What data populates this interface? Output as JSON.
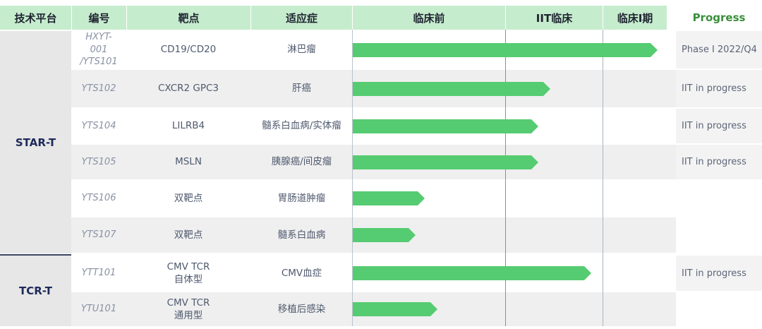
{
  "header": {
    "platform": "技术平台",
    "code": "编号",
    "target": "靶点",
    "indication": "适应症",
    "preclinical": "临床前",
    "iit": "IIT临床",
    "phase1": "临床I期",
    "progress": "Progress"
  },
  "platforms": [
    {
      "name": "STAR-T"
    },
    {
      "name": "TCR-T"
    }
  ],
  "rows": [
    {
      "code": "HXYT-\n001\n/YTS101",
      "target": "CD19/CD20",
      "indication": "淋巴瘤",
      "progress": "Phase I 2022/Q4",
      "stage_fraction": 0.97
    },
    {
      "code": "YTS102",
      "target": "CXCR2 GPC3",
      "indication": "肝癌",
      "progress": "IIT in progress",
      "stage_fraction": 0.63
    },
    {
      "code": "YTS104",
      "target": "LILRB4",
      "indication": "髓系白血病/实体瘤",
      "progress": "IIT in progress",
      "stage_fraction": 0.59
    },
    {
      "code": "YTS105",
      "target": "MSLN",
      "indication": "胰腺癌/间皮瘤",
      "progress": "IIT in progress",
      "stage_fraction": 0.59
    },
    {
      "code": "YTS106",
      "target": "双靶点",
      "indication": "胃肠道肿瘤",
      "progress": "",
      "stage_fraction": 0.23
    },
    {
      "code": "YTS107",
      "target": "双靶点",
      "indication": "髓系白血病",
      "progress": "",
      "stage_fraction": 0.2
    },
    {
      "code": "YTT101",
      "target": "CMV TCR\n自体型",
      "indication": "CMV血症",
      "progress": "IIT in progress",
      "stage_fraction": 0.76
    },
    {
      "code": "YTU101",
      "target": "CMV TCR\n通用型",
      "indication": "移植后感染",
      "progress": "",
      "stage_fraction": 0.27
    }
  ],
  "colors": {
    "header_bg": "#c6ecce",
    "bar": "#55cc71",
    "platform_bg": "#e7e7e7",
    "platform_text": "#1d2a5a",
    "progress_header": "#3a8f3a"
  }
}
